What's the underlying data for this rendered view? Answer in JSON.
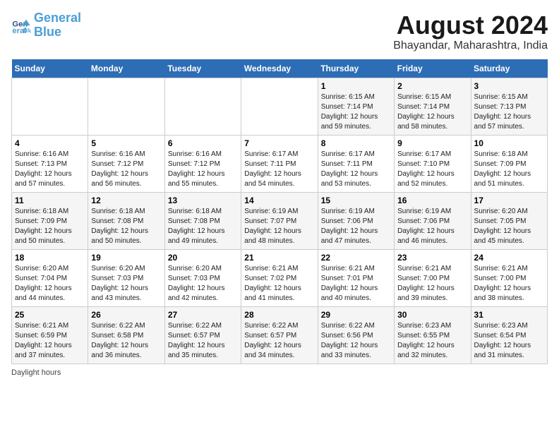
{
  "header": {
    "logo_line1": "General",
    "logo_line2": "Blue",
    "title": "August 2024",
    "subtitle": "Bhayandar, Maharashtra, India"
  },
  "days_of_week": [
    "Sunday",
    "Monday",
    "Tuesday",
    "Wednesday",
    "Thursday",
    "Friday",
    "Saturday"
  ],
  "weeks": [
    [
      {
        "day": "",
        "info": ""
      },
      {
        "day": "",
        "info": ""
      },
      {
        "day": "",
        "info": ""
      },
      {
        "day": "",
        "info": ""
      },
      {
        "day": "1",
        "info": "Sunrise: 6:15 AM\nSunset: 7:14 PM\nDaylight: 12 hours\nand 59 minutes."
      },
      {
        "day": "2",
        "info": "Sunrise: 6:15 AM\nSunset: 7:14 PM\nDaylight: 12 hours\nand 58 minutes."
      },
      {
        "day": "3",
        "info": "Sunrise: 6:15 AM\nSunset: 7:13 PM\nDaylight: 12 hours\nand 57 minutes."
      }
    ],
    [
      {
        "day": "4",
        "info": "Sunrise: 6:16 AM\nSunset: 7:13 PM\nDaylight: 12 hours\nand 57 minutes."
      },
      {
        "day": "5",
        "info": "Sunrise: 6:16 AM\nSunset: 7:12 PM\nDaylight: 12 hours\nand 56 minutes."
      },
      {
        "day": "6",
        "info": "Sunrise: 6:16 AM\nSunset: 7:12 PM\nDaylight: 12 hours\nand 55 minutes."
      },
      {
        "day": "7",
        "info": "Sunrise: 6:17 AM\nSunset: 7:11 PM\nDaylight: 12 hours\nand 54 minutes."
      },
      {
        "day": "8",
        "info": "Sunrise: 6:17 AM\nSunset: 7:11 PM\nDaylight: 12 hours\nand 53 minutes."
      },
      {
        "day": "9",
        "info": "Sunrise: 6:17 AM\nSunset: 7:10 PM\nDaylight: 12 hours\nand 52 minutes."
      },
      {
        "day": "10",
        "info": "Sunrise: 6:18 AM\nSunset: 7:09 PM\nDaylight: 12 hours\nand 51 minutes."
      }
    ],
    [
      {
        "day": "11",
        "info": "Sunrise: 6:18 AM\nSunset: 7:09 PM\nDaylight: 12 hours\nand 50 minutes."
      },
      {
        "day": "12",
        "info": "Sunrise: 6:18 AM\nSunset: 7:08 PM\nDaylight: 12 hours\nand 50 minutes."
      },
      {
        "day": "13",
        "info": "Sunrise: 6:18 AM\nSunset: 7:08 PM\nDaylight: 12 hours\nand 49 minutes."
      },
      {
        "day": "14",
        "info": "Sunrise: 6:19 AM\nSunset: 7:07 PM\nDaylight: 12 hours\nand 48 minutes."
      },
      {
        "day": "15",
        "info": "Sunrise: 6:19 AM\nSunset: 7:06 PM\nDaylight: 12 hours\nand 47 minutes."
      },
      {
        "day": "16",
        "info": "Sunrise: 6:19 AM\nSunset: 7:06 PM\nDaylight: 12 hours\nand 46 minutes."
      },
      {
        "day": "17",
        "info": "Sunrise: 6:20 AM\nSunset: 7:05 PM\nDaylight: 12 hours\nand 45 minutes."
      }
    ],
    [
      {
        "day": "18",
        "info": "Sunrise: 6:20 AM\nSunset: 7:04 PM\nDaylight: 12 hours\nand 44 minutes."
      },
      {
        "day": "19",
        "info": "Sunrise: 6:20 AM\nSunset: 7:03 PM\nDaylight: 12 hours\nand 43 minutes."
      },
      {
        "day": "20",
        "info": "Sunrise: 6:20 AM\nSunset: 7:03 PM\nDaylight: 12 hours\nand 42 minutes."
      },
      {
        "day": "21",
        "info": "Sunrise: 6:21 AM\nSunset: 7:02 PM\nDaylight: 12 hours\nand 41 minutes."
      },
      {
        "day": "22",
        "info": "Sunrise: 6:21 AM\nSunset: 7:01 PM\nDaylight: 12 hours\nand 40 minutes."
      },
      {
        "day": "23",
        "info": "Sunrise: 6:21 AM\nSunset: 7:00 PM\nDaylight: 12 hours\nand 39 minutes."
      },
      {
        "day": "24",
        "info": "Sunrise: 6:21 AM\nSunset: 7:00 PM\nDaylight: 12 hours\nand 38 minutes."
      }
    ],
    [
      {
        "day": "25",
        "info": "Sunrise: 6:21 AM\nSunset: 6:59 PM\nDaylight: 12 hours\nand 37 minutes."
      },
      {
        "day": "26",
        "info": "Sunrise: 6:22 AM\nSunset: 6:58 PM\nDaylight: 12 hours\nand 36 minutes."
      },
      {
        "day": "27",
        "info": "Sunrise: 6:22 AM\nSunset: 6:57 PM\nDaylight: 12 hours\nand 35 minutes."
      },
      {
        "day": "28",
        "info": "Sunrise: 6:22 AM\nSunset: 6:57 PM\nDaylight: 12 hours\nand 34 minutes."
      },
      {
        "day": "29",
        "info": "Sunrise: 6:22 AM\nSunset: 6:56 PM\nDaylight: 12 hours\nand 33 minutes."
      },
      {
        "day": "30",
        "info": "Sunrise: 6:23 AM\nSunset: 6:55 PM\nDaylight: 12 hours\nand 32 minutes."
      },
      {
        "day": "31",
        "info": "Sunrise: 6:23 AM\nSunset: 6:54 PM\nDaylight: 12 hours\nand 31 minutes."
      }
    ]
  ],
  "footer": {
    "note": "Daylight hours"
  }
}
